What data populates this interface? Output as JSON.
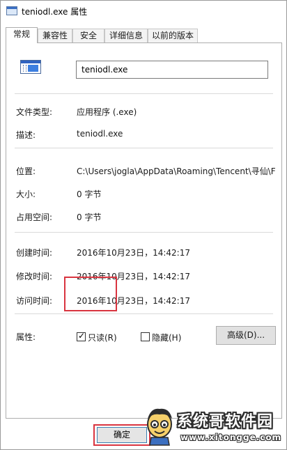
{
  "window": {
    "title": "teniodl.exe 属性",
    "icon": "exe-window-icon"
  },
  "tabs": [
    {
      "label": "常规",
      "active": true
    },
    {
      "label": "兼容性",
      "active": false
    },
    {
      "label": "安全",
      "active": false
    },
    {
      "label": "详细信息",
      "active": false
    },
    {
      "label": "以前的版本",
      "active": false
    }
  ],
  "general": {
    "file_name": "teniodl.exe",
    "file_type_label": "文件类型:",
    "file_type_value": "应用程序 (.exe)",
    "description_label": "描述:",
    "description_value": "teniodl.exe",
    "location_label": "位置:",
    "location_value": "C:\\Users\\jogla\\AppData\\Roaming\\Tencent\\寻仙\\F",
    "size_label": "大小:",
    "size_value": "0 字节",
    "size_on_disk_label": "占用空间:",
    "size_on_disk_value": "0 字节",
    "created_label": "创建时间:",
    "created_value": "2016年10月23日，14:42:17",
    "modified_label": "修改时间:",
    "modified_value": "2016年10月23日，14:42:17",
    "accessed_label": "访问时间:",
    "accessed_value": "2016年10月23日，14:42:17",
    "attributes_label": "属性:",
    "readonly_label": "只读(R)",
    "readonly_checked": true,
    "hidden_label": "隐藏(H)",
    "hidden_checked": false,
    "advanced_button": "高级(D)..."
  },
  "footer": {
    "ok_button": "确定"
  },
  "watermark": {
    "name": "系统哥软件园",
    "url": "www.xitongge.com"
  },
  "colors": {
    "highlight": "#d9343f",
    "icon_blue": "#2f63c0"
  }
}
